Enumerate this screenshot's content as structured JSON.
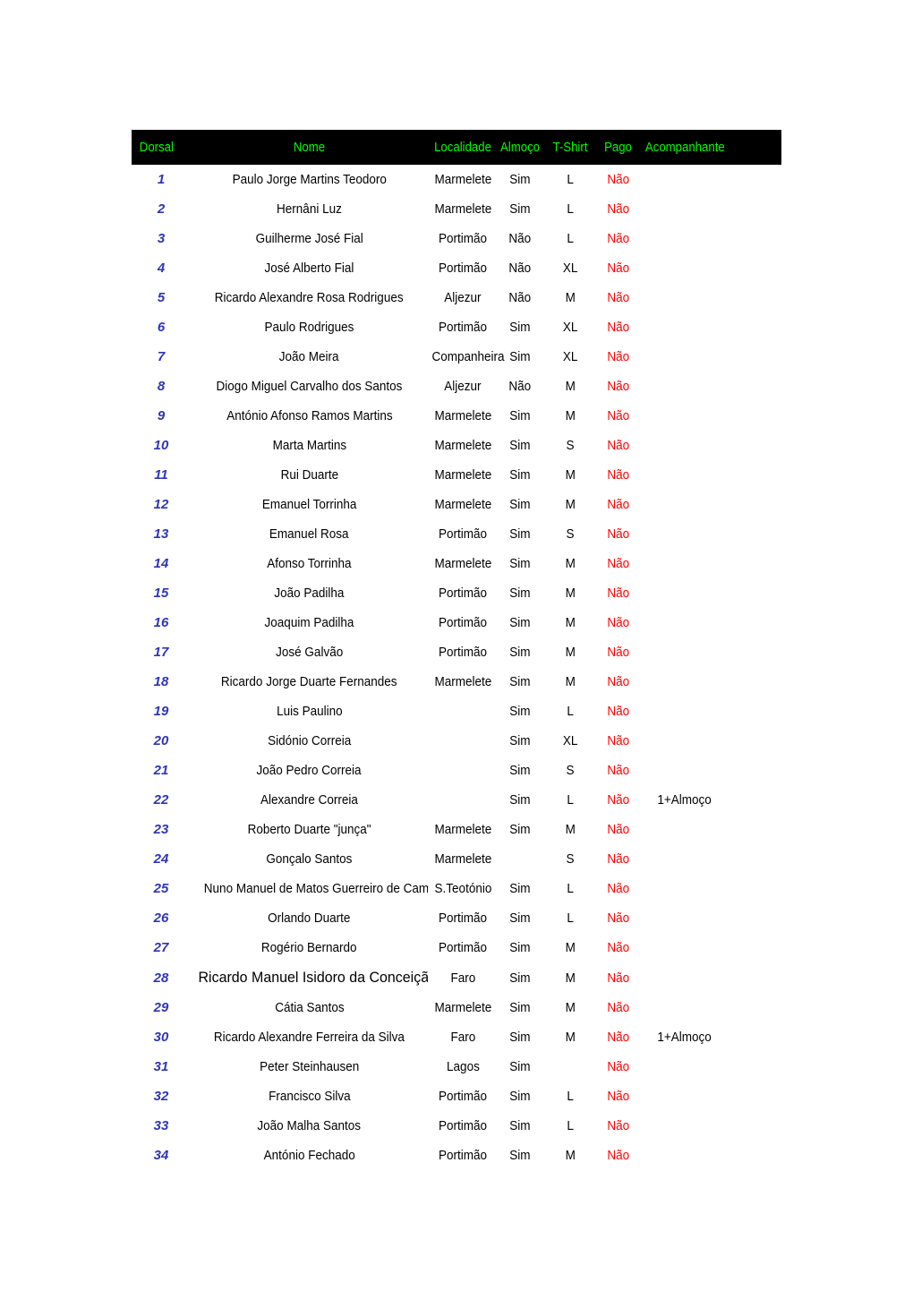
{
  "document": {
    "type": "spreadsheet-roster-table"
  },
  "table": {
    "columns": [
      {
        "key": "dorsal",
        "label": "Dorsal"
      },
      {
        "key": "nome",
        "label": "Nome"
      },
      {
        "key": "localidade",
        "label": "Localidade"
      },
      {
        "key": "almoco",
        "label": "Almoço"
      },
      {
        "key": "tshirt",
        "label": "T-Shirt"
      },
      {
        "key": "pago",
        "label": "Pago"
      },
      {
        "key": "acompanhante",
        "label": "Acompanhante"
      }
    ],
    "header_style": {
      "background": "#000000",
      "text_color": "#00FF00"
    },
    "cell_colors": {
      "dorsal": "#2E35B8",
      "default": "#000000",
      "pago": "#FF0000"
    },
    "rows": [
      {
        "dorsal": "1",
        "nome": "Paulo Jorge Martins Teodoro",
        "localidade": "Marmelete",
        "almoco": "Sim",
        "tshirt": "L",
        "pago": "Não",
        "acompanhante": ""
      },
      {
        "dorsal": "2",
        "nome": "Hernâni Luz",
        "localidade": "Marmelete",
        "almoco": "Sim",
        "tshirt": "L",
        "pago": "Não",
        "acompanhante": ""
      },
      {
        "dorsal": "3",
        "nome": "Guilherme José Fial",
        "localidade": "Portimão",
        "almoco": "Não",
        "tshirt": "L",
        "pago": "Não",
        "acompanhante": ""
      },
      {
        "dorsal": "4",
        "nome": "José Alberto Fial",
        "localidade": "Portimão",
        "almoco": "Não",
        "tshirt": "XL",
        "pago": "Não",
        "acompanhante": ""
      },
      {
        "dorsal": "5",
        "nome": "Ricardo Alexandre Rosa Rodrigues",
        "localidade": "Aljezur",
        "almoco": "Não",
        "tshirt": "M",
        "pago": "Não",
        "acompanhante": ""
      },
      {
        "dorsal": "6",
        "nome": "Paulo Rodrigues",
        "localidade": "Portimão",
        "almoco": "Sim",
        "tshirt": "XL",
        "pago": "Não",
        "acompanhante": ""
      },
      {
        "dorsal": "7",
        "nome": "João Meira",
        "localidade": "Companheira",
        "almoco": "Sim",
        "tshirt": "XL",
        "pago": "Não",
        "acompanhante": ""
      },
      {
        "dorsal": "8",
        "nome": "Diogo Miguel Carvalho dos Santos",
        "localidade": "Aljezur",
        "almoco": "Não",
        "tshirt": "M",
        "pago": "Não",
        "acompanhante": ""
      },
      {
        "dorsal": "9",
        "nome": "António Afonso Ramos Martins",
        "localidade": "Marmelete",
        "almoco": "Sim",
        "tshirt": "M",
        "pago": "Não",
        "acompanhante": ""
      },
      {
        "dorsal": "10",
        "nome": "Marta Martins",
        "localidade": "Marmelete",
        "almoco": "Sim",
        "tshirt": "S",
        "pago": "Não",
        "acompanhante": ""
      },
      {
        "dorsal": "11",
        "nome": "Rui Duarte",
        "localidade": "Marmelete",
        "almoco": "Sim",
        "tshirt": "M",
        "pago": "Não",
        "acompanhante": ""
      },
      {
        "dorsal": "12",
        "nome": "Emanuel Torrinha",
        "localidade": "Marmelete",
        "almoco": "Sim",
        "tshirt": "M",
        "pago": "Não",
        "acompanhante": ""
      },
      {
        "dorsal": "13",
        "nome": "Emanuel Rosa",
        "localidade": "Portimão",
        "almoco": "Sim",
        "tshirt": "S",
        "pago": "Não",
        "acompanhante": ""
      },
      {
        "dorsal": "14",
        "nome": "Afonso Torrinha",
        "localidade": "Marmelete",
        "almoco": "Sim",
        "tshirt": "M",
        "pago": "Não",
        "acompanhante": ""
      },
      {
        "dorsal": "15",
        "nome": "João Padilha",
        "localidade": "Portimão",
        "almoco": "Sim",
        "tshirt": "M",
        "pago": "Não",
        "acompanhante": ""
      },
      {
        "dorsal": "16",
        "nome": "Joaquim Padilha",
        "localidade": "Portimão",
        "almoco": "Sim",
        "tshirt": "M",
        "pago": "Não",
        "acompanhante": ""
      },
      {
        "dorsal": "17",
        "nome": "José Galvão",
        "localidade": "Portimão",
        "almoco": "Sim",
        "tshirt": "M",
        "pago": "Não",
        "acompanhante": ""
      },
      {
        "dorsal": "18",
        "nome": "Ricardo Jorge Duarte Fernandes",
        "localidade": "Marmelete",
        "almoco": "Sim",
        "tshirt": "M",
        "pago": "Não",
        "acompanhante": ""
      },
      {
        "dorsal": "19",
        "nome": "Luis Paulino",
        "localidade": "",
        "almoco": "Sim",
        "tshirt": "L",
        "pago": "Não",
        "acompanhante": ""
      },
      {
        "dorsal": "20",
        "nome": "Sidónio Correia",
        "localidade": "",
        "almoco": "Sim",
        "tshirt": "XL",
        "pago": "Não",
        "acompanhante": ""
      },
      {
        "dorsal": "21",
        "nome": "João Pedro Correia",
        "localidade": "",
        "almoco": "Sim",
        "tshirt": "S",
        "pago": "Não",
        "acompanhante": ""
      },
      {
        "dorsal": "22",
        "nome": "Alexandre Correia",
        "localidade": "",
        "almoco": "Sim",
        "tshirt": "L",
        "pago": "Não",
        "acompanhante": "1+Almoço"
      },
      {
        "dorsal": "23",
        "nome": "Roberto Duarte \"junça\"",
        "localidade": "Marmelete",
        "almoco": "Sim",
        "tshirt": "M",
        "pago": "Não",
        "acompanhante": ""
      },
      {
        "dorsal": "24",
        "nome": "Gonçalo Santos",
        "localidade": "Marmelete",
        "almoco": "",
        "tshirt": "S",
        "pago": "Não",
        "acompanhante": ""
      },
      {
        "dorsal": "25",
        "nome": "Nuno Manuel de Matos Guerreiro de Campo",
        "localidade": "S.Teotónio",
        "almoco": "Sim",
        "tshirt": "L",
        "pago": "Não",
        "acompanhante": ""
      },
      {
        "dorsal": "26",
        "nome": "Orlando Duarte",
        "localidade": "Portimão",
        "almoco": "Sim",
        "tshirt": "L",
        "pago": "Não",
        "acompanhante": ""
      },
      {
        "dorsal": "27",
        "nome": "Rogério Bernardo",
        "localidade": "Portimão",
        "almoco": "Sim",
        "tshirt": "M",
        "pago": "Não",
        "acompanhante": ""
      },
      {
        "dorsal": "28",
        "nome": "Ricardo Manuel Isidoro da Conceição",
        "localidade": "Faro",
        "almoco": "Sim",
        "tshirt": "M",
        "pago": "Não",
        "acompanhante": ""
      },
      {
        "dorsal": "29",
        "nome": "Cátia Santos",
        "localidade": "Marmelete",
        "almoco": "Sim",
        "tshirt": "M",
        "pago": "Não",
        "acompanhante": ""
      },
      {
        "dorsal": "30",
        "nome": "Ricardo Alexandre Ferreira da Silva",
        "localidade": "Faro",
        "almoco": "Sim",
        "tshirt": "M",
        "pago": "Não",
        "acompanhante": "1+Almoço"
      },
      {
        "dorsal": "31",
        "nome": "Peter Steinhausen",
        "localidade": "Lagos",
        "almoco": "Sim",
        "tshirt": "",
        "pago": "Não",
        "acompanhante": ""
      },
      {
        "dorsal": "32",
        "nome": "Francisco Silva",
        "localidade": "Portimão",
        "almoco": "Sim",
        "tshirt": "L",
        "pago": "Não",
        "acompanhante": ""
      },
      {
        "dorsal": "33",
        "nome": "João Malha Santos",
        "localidade": "Portimão",
        "almoco": "Sim",
        "tshirt": "L",
        "pago": "Não",
        "acompanhante": ""
      },
      {
        "dorsal": "34",
        "nome": "António Fechado",
        "localidade": "Portimão",
        "almoco": "Sim",
        "tshirt": "M",
        "pago": "Não",
        "acompanhante": ""
      }
    ]
  }
}
